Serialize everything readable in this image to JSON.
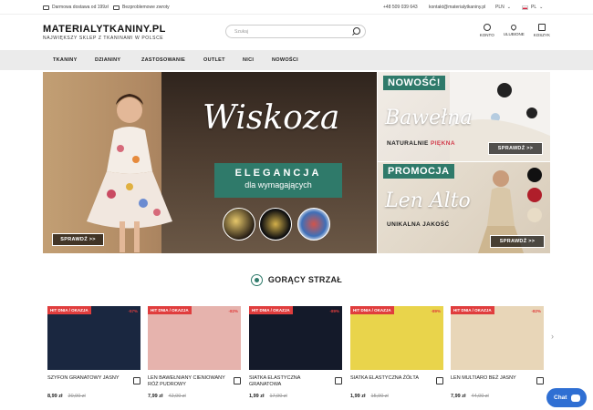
{
  "topbar": {
    "shipping": "Darmowa dostawa od 199zł",
    "returns": "Bezproblemowe zwroty",
    "phone": "+48 509 039 643",
    "email": "kontakt@materialytkaniny.pl",
    "currency": "PLN",
    "language": "PL"
  },
  "header": {
    "logo_main": "MATERIALYTKANINY.PL",
    "logo_sub": "NAJWIĘKSZY SKLEP Z TKANINAMI W POLSCE",
    "search_placeholder": "Szukaj",
    "account_label": "KONTO",
    "favorites_label": "ULUBIONE",
    "cart_label": "KOSZYK"
  },
  "nav": [
    "TKANINY",
    "DZIANINY",
    "ZASTOSOWANIE",
    "OUTLET",
    "NICI",
    "NOWOŚCI"
  ],
  "hero": {
    "title": "Wiskoza",
    "band_line1": "ELEGANCJA",
    "band_line2": "dla wymagających",
    "button": "SPRAWDŹ >>"
  },
  "promo_new": {
    "tag": "NOWOŚĆ!",
    "title": "Bawełna",
    "subtitle_plain": "NATURALNIE",
    "subtitle_accent": "PIĘKNA",
    "button": "SPRAWDŹ >>"
  },
  "promo_sale": {
    "tag": "PROMOCJA",
    "title": "Len Alto",
    "subtitle": "UNIKALNA JAKOŚĆ",
    "button": "SPRAWDŹ >>"
  },
  "section_title": "GORĄCY STRZAŁ",
  "products": [
    {
      "badge": "HIT DNIA / OKAZJA",
      "discount": "-57%",
      "name": "SZYFON GRANATOWY JASNY",
      "price": "8,99 zł",
      "old_price": "20,90 zł",
      "color": "#1a2740"
    },
    {
      "badge": "HIT DNIA / OKAZJA",
      "discount": "-82%",
      "name": "LEN BAWEŁNIANY CIENIOWANY RÓŻ PUDROWY",
      "price": "7,99 zł",
      "old_price": "42,00 zł",
      "color": "#e6b3ad"
    },
    {
      "badge": "HIT DNIA / OKAZJA",
      "discount": "-89%",
      "name": "SIATKA ELASTYCZNA GRANATOWA",
      "price": "1,99 zł",
      "old_price": "17,90 zł",
      "color": "#141a2a"
    },
    {
      "badge": "HIT DNIA / OKAZJA",
      "discount": "-89%",
      "name": "SIATKA ELASTYCZNA ŻÓŁTA",
      "price": "1,99 zł",
      "old_price": "15,90 zł",
      "color": "#e9d44b"
    },
    {
      "badge": "HIT DNIA / OKAZJA",
      "discount": "-82%",
      "name": "LEN MULTIARO BEŻ JASNY",
      "price": "7,99 zł",
      "old_price": "44,00 zł",
      "color": "#e8d6b8"
    }
  ],
  "chat_label": "Chat"
}
